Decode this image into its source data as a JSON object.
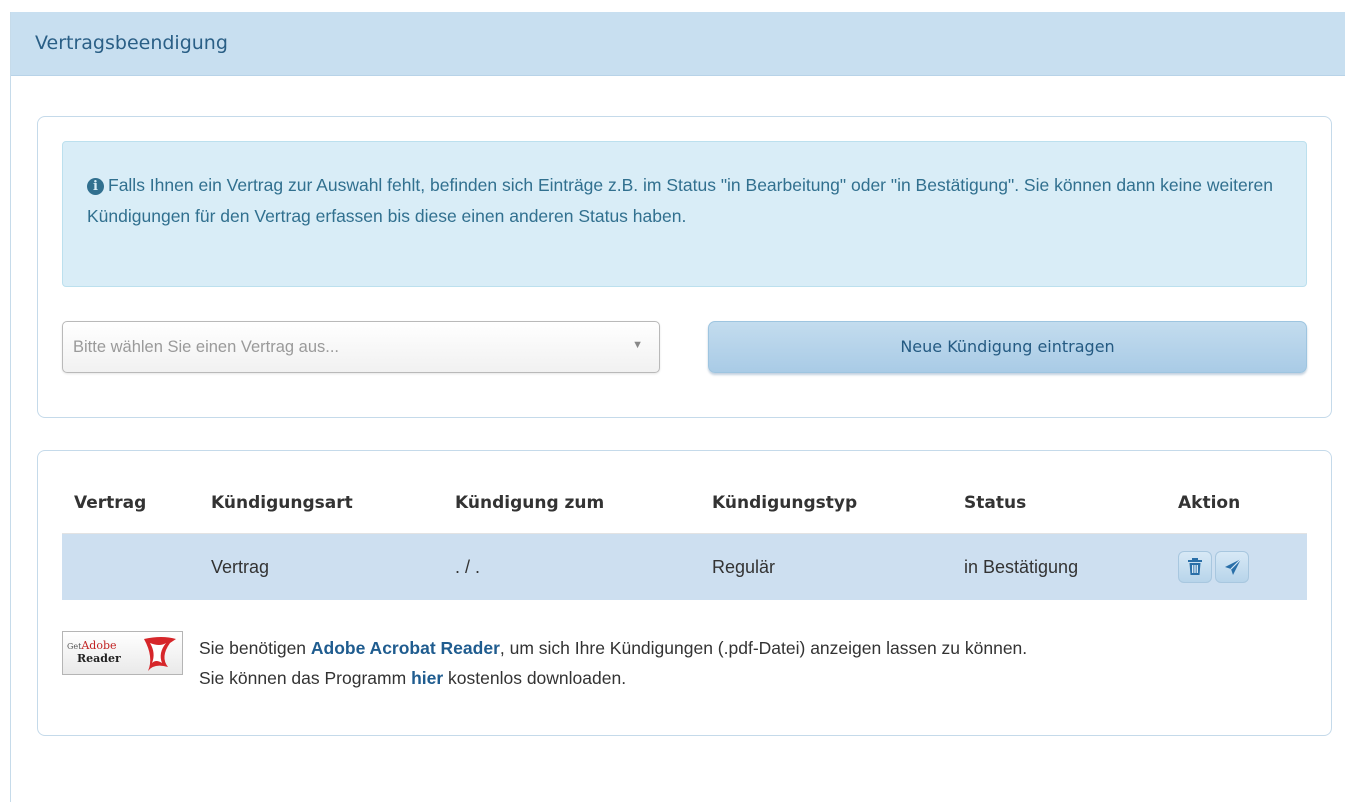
{
  "panel": {
    "title": "Vertragsbeendigung"
  },
  "alert": {
    "icon": "info-circle-icon",
    "text": "Falls Ihnen ein Vertrag zur Auswahl fehlt, befinden sich Einträge z.B. im Status \"in Bearbeitung\" oder \"in Bestätigung\". Sie können dann keine weiteren Kündigungen für den Vertrag erfassen bis diese einen anderen Status haben."
  },
  "contract_select": {
    "placeholder": "Bitte wählen Sie einen Vertrag aus..."
  },
  "new_termination_button": {
    "label": "Neue Kündigung eintragen"
  },
  "table": {
    "headers": [
      "Vertrag",
      "Kündigungsart",
      "Kündigung zum",
      "Kündigungstyp",
      "Status",
      "Aktion"
    ],
    "rows": [
      {
        "vertrag": "",
        "kuendigungsart": "Vertrag",
        "kuendigung_zum": ". / .",
        "kuendigungstyp": "Regulär",
        "status": "in Bestätigung",
        "actions": [
          "trash-icon",
          "send-icon"
        ]
      }
    ]
  },
  "adobe": {
    "badge": {
      "get": "Get",
      "brand": "Adobe",
      "reader": "Reader"
    },
    "note_prefix": "Sie benötigen ",
    "note_link": "Adobe Acrobat Reader",
    "note_middle": ", um sich Ihre Kündigungen (.pdf-Datei) anzeigen lassen zu können.",
    "note_line2_prefix": "Sie können das Programm ",
    "note_line2_link": "hier",
    "note_line2_suffix": " kostenlos downloaden."
  },
  "colors": {
    "heading_bg": "#c8dff0",
    "heading_text": "#2a5f86",
    "alert_bg": "#d9edf7",
    "alert_text": "#31708f",
    "row_bg": "#cddff0",
    "link": "#1f5c8f"
  }
}
